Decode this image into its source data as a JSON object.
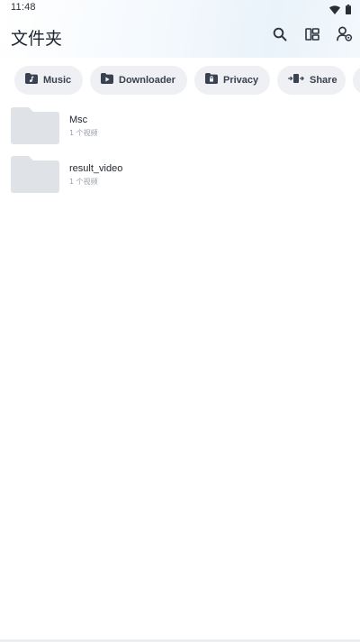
{
  "status_bar": {
    "time": "11:48",
    "icons": [
      "wifi-icon",
      "battery-icon"
    ]
  },
  "header": {
    "title": "文件夹",
    "actions": [
      {
        "name": "search",
        "icon": "search-icon"
      },
      {
        "name": "layout",
        "icon": "layout-icon"
      },
      {
        "name": "account",
        "icon": "user-settings-icon"
      }
    ]
  },
  "chips": [
    {
      "label": "Music",
      "icon": "music-folder-icon"
    },
    {
      "label": "Downloader",
      "icon": "download-folder-icon"
    },
    {
      "label": "Privacy",
      "icon": "lock-folder-icon"
    },
    {
      "label": "Share",
      "icon": "share-icon"
    }
  ],
  "folders": [
    {
      "name": "Msc",
      "count": "1 个视频"
    },
    {
      "name": "result_video",
      "count": "1 个视频"
    }
  ],
  "colors": {
    "chip_background": "#eef0f3",
    "folder_thumbnail": "#dfe2e6",
    "icon": "#3a4150"
  }
}
